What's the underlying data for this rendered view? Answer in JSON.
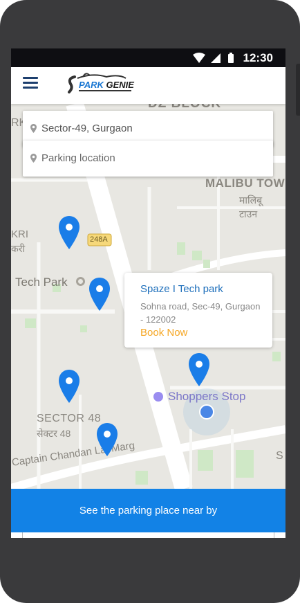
{
  "status_bar": {
    "time": "12:30"
  },
  "app": {
    "brand_prefix": "ARK",
    "brand_suffix": "GENIE",
    "brand_initial": "P"
  },
  "search": {
    "origin_value": "Sector-49, Gurgaon",
    "destination_placeholder": "Parking location"
  },
  "map": {
    "labels": {
      "dz_block": "DZ BLOCK",
      "malibu": "MALIBU TOW",
      "malibu_hindi": "मालिबू",
      "town_hindi": "टाउन",
      "kri": "KRI",
      "kri_hindi": "करी",
      "route": "248A",
      "tech_park": "Tech Park",
      "shoppers_stop": "Shoppers Stop",
      "sector48": "SECTOR 48",
      "sector48_hindi": "सेक्टर 48",
      "road": "Captain Chandan Lal Marg",
      "rk": "RK",
      "s": "S"
    }
  },
  "popup": {
    "title": "Spaze I Tech park",
    "address": "Sohna road, Sec-49, Gurgaon - 122002",
    "book_label": "Book Now"
  },
  "cta": {
    "label": "See the parking place near by"
  },
  "colors": {
    "primary": "#1282e6",
    "marker": "#1a7de8",
    "accent": "#f5a623"
  }
}
